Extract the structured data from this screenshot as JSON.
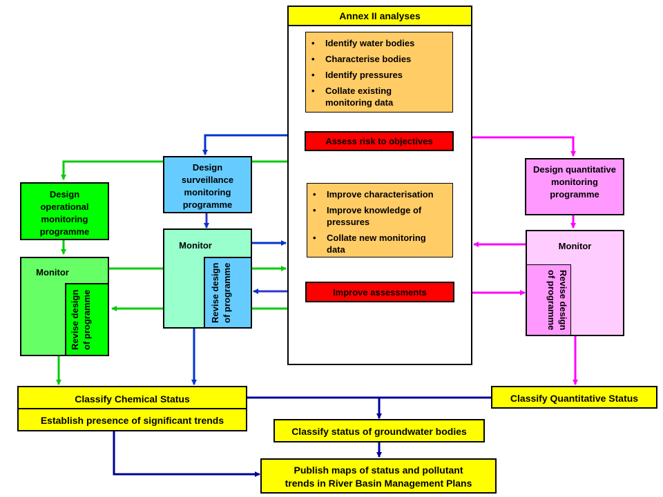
{
  "colors": {
    "yellow": "#ffff00",
    "orange": "#ffcc66",
    "red": "#ff0000",
    "green_dark": "#00ff00",
    "green_light": "#66ff66",
    "blue_box": "#66ccff",
    "mint": "#99ffcc",
    "pink_dark": "#ff99ff",
    "pink_light": "#ffccff",
    "line_green": "#00cc00",
    "line_blue": "#0033cc",
    "line_navy": "#000099",
    "line_magenta": "#ff00ff"
  },
  "annex": {
    "title": "Annex II analyses",
    "initial_steps": [
      "Identify water bodies",
      "Characterise bodies",
      "Identify pressures",
      "Collate existing monitoring data"
    ],
    "assess": "Assess risk to objectives",
    "improve_steps": [
      "Improve characterisation",
      "Improve knowledge of pressures",
      "Collate new monitoring data"
    ],
    "improve": "Improve assessments"
  },
  "operational": {
    "design": "Design operational monitoring programme",
    "monitor": "Monitor",
    "revise": "Revise design of programme"
  },
  "surveillance": {
    "design": "Design surveillance monitoring programme",
    "monitor": "Monitor",
    "revise": "Revise design of programme"
  },
  "quantitative": {
    "design": "Design quantitative monitoring programme",
    "monitor": "Monitor",
    "revise": "Revise design of programme"
  },
  "outputs": {
    "chemical": "Classify Chemical Status",
    "trends": "Establish presence of significant trends",
    "quantitative": "Classify Quantitative Status",
    "groundwater": "Classify status of groundwater bodies",
    "publish_line1": "Publish maps of status and pollutant",
    "publish_line2": "trends in River Basin Management Plans"
  }
}
